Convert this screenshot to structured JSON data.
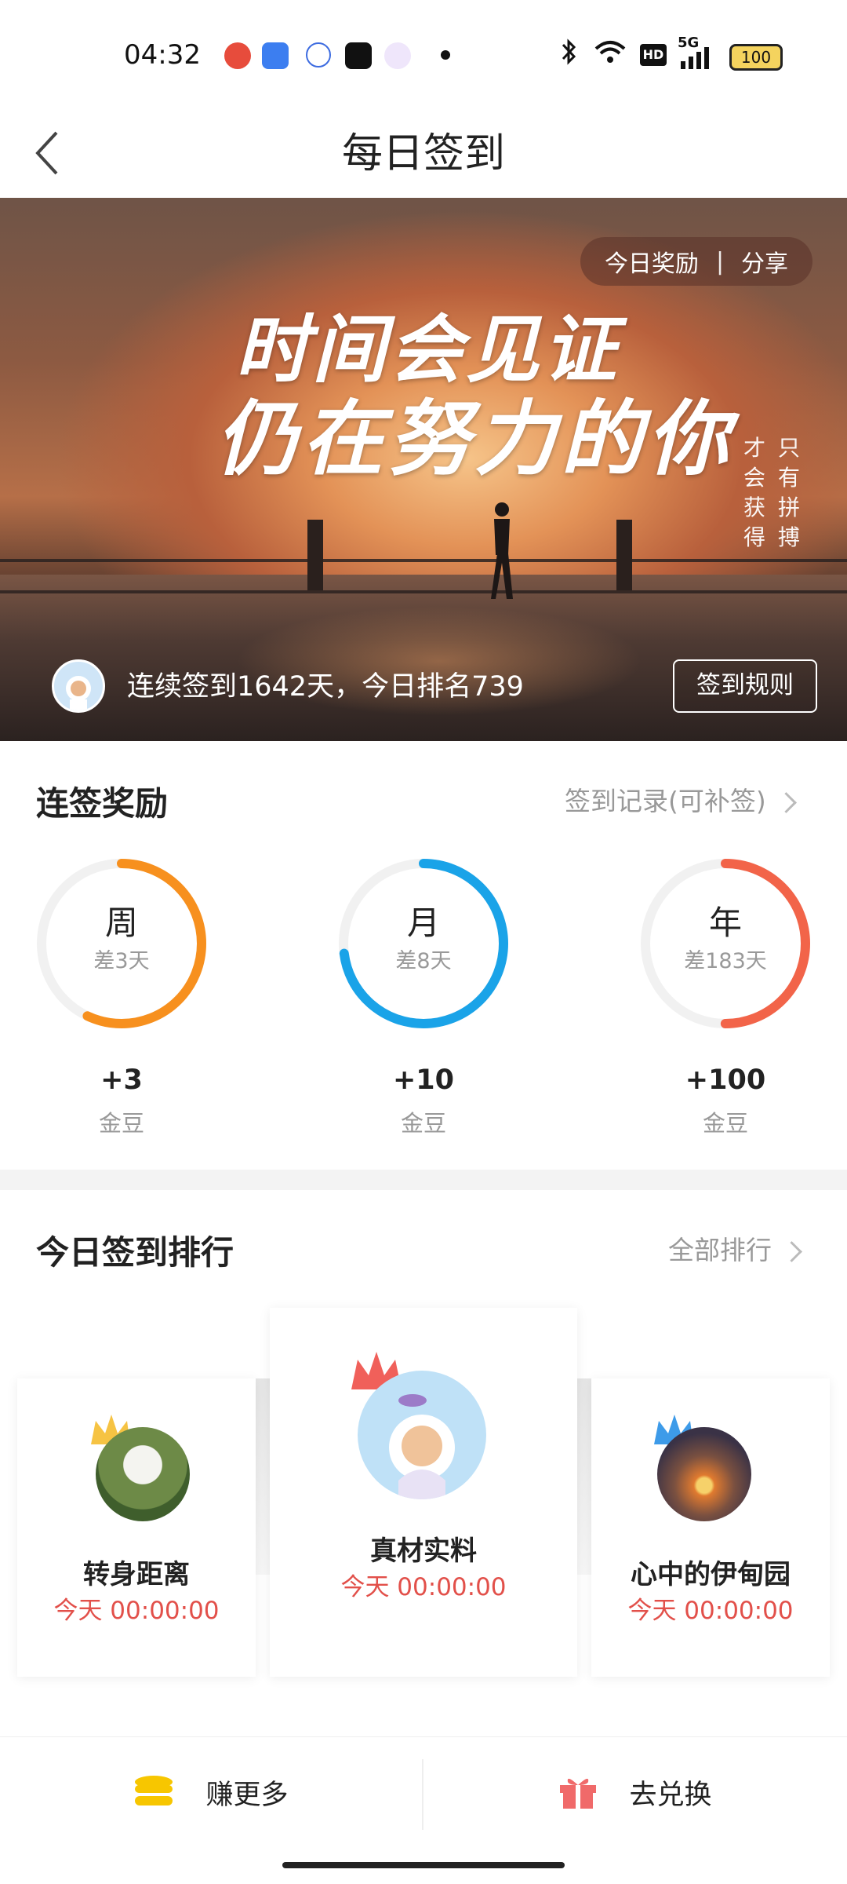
{
  "status_bar": {
    "time": "04:32",
    "network": "5G",
    "hd": "HD",
    "battery": "100"
  },
  "header": {
    "title": "每日签到"
  },
  "banner": {
    "headline_line1": "时间会见证",
    "headline_line2": "仍在努力的你",
    "vertical_right": "只有拼搏",
    "vertical_left": "才会获得",
    "today_reward": "今日奖励",
    "share": "分享",
    "separator": "|",
    "streak_text": "连续签到1642天，今日排名739",
    "rules_button": "签到规则"
  },
  "streak_rewards": {
    "title": "连签奖励",
    "record_link": "签到记录(可补签)",
    "items": [
      {
        "label": "周",
        "remaining": "差3天",
        "reward": "+3",
        "unit": "金豆",
        "color": "#f7901e",
        "progress": 0.57
      },
      {
        "label": "月",
        "remaining": "差8天",
        "reward": "+10",
        "unit": "金豆",
        "color": "#1aa3e8",
        "progress": 0.73
      },
      {
        "label": "年",
        "remaining": "差183天",
        "reward": "+100",
        "unit": "金豆",
        "color": "#f26449",
        "progress": 0.5
      }
    ]
  },
  "ranking": {
    "title": "今日签到排行",
    "all_link": "全部排行",
    "entries": [
      {
        "name": "真材实料",
        "time": "今天 00:00:00",
        "crown_color": "#f0605a"
      },
      {
        "name": "转身距离",
        "time": "今天 00:00:00",
        "crown_color": "#f6c343"
      },
      {
        "name": "心中的伊甸园",
        "time": "今天 00:00:00",
        "crown_color": "#3d9be9"
      }
    ]
  },
  "bottom_bar": {
    "earn_more": "赚更多",
    "redeem": "去兑换"
  }
}
